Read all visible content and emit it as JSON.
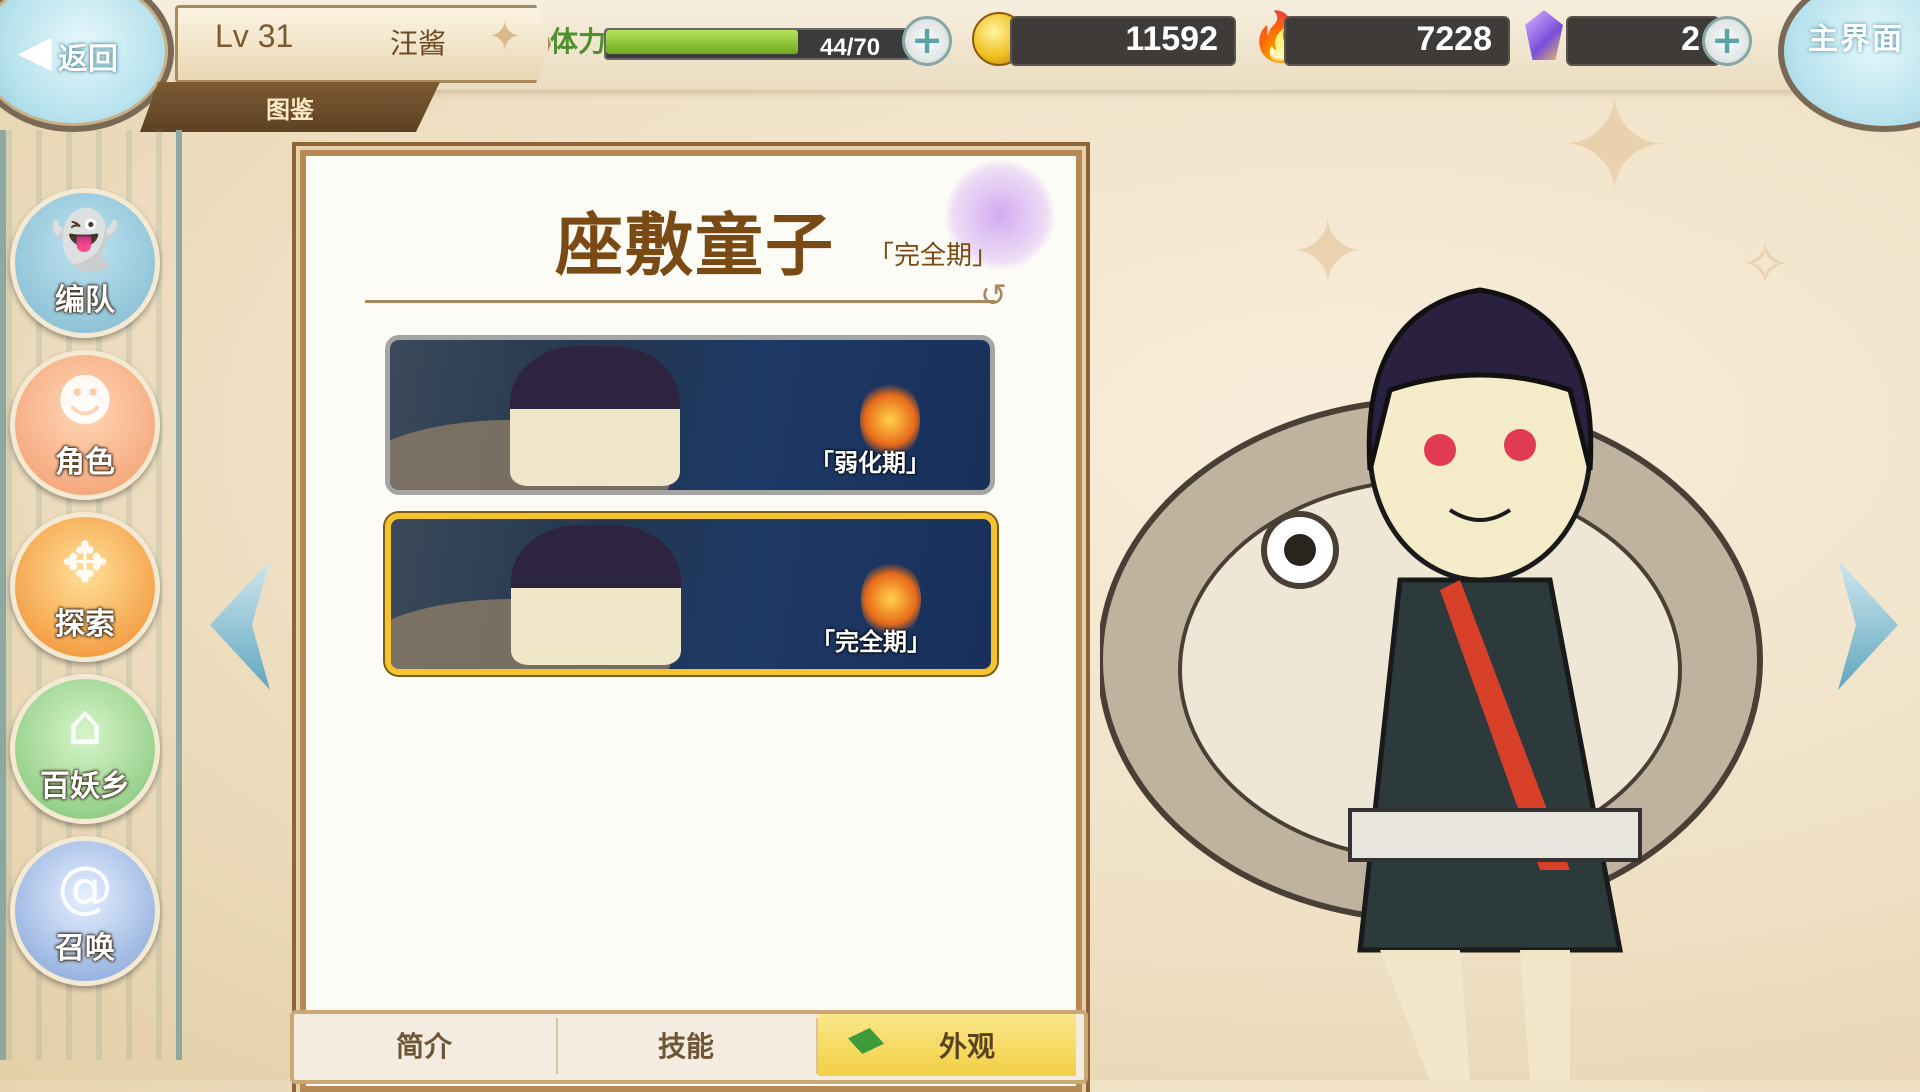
{
  "header": {
    "back_label": "返回",
    "level": "Lv 31",
    "player_name": "汪酱",
    "section_tab": "图鉴",
    "stamina_label": "体力",
    "stamina_text": "44/70",
    "stamina_fraction": 0.629,
    "gold": "11592",
    "soul": "7228",
    "gems": "2",
    "home_label": "主界面"
  },
  "nav": [
    {
      "label": "编队",
      "icon": "ghost-knight-icon"
    },
    {
      "label": "角色",
      "icon": "character-portrait-icon"
    },
    {
      "label": "探索",
      "icon": "scroll-compass-icon"
    },
    {
      "label": "百妖乡",
      "icon": "house-icon"
    },
    {
      "label": "召唤",
      "icon": "swirl-icon"
    }
  ],
  "codex": {
    "character_name": "座敷童子",
    "current_stage": "「完全期」",
    "skins": [
      {
        "stage": "「弱化期」",
        "selected": false
      },
      {
        "stage": "「完全期」",
        "selected": true
      }
    ]
  },
  "tabs": [
    {
      "label": "简介",
      "active": false
    },
    {
      "label": "技能",
      "active": false
    },
    {
      "label": "外观",
      "active": true
    }
  ],
  "colors": {
    "panel_border": "#b78a55",
    "selected_border": "#f3c330",
    "active_tab": "#f2cf45",
    "title_text": "#7a4a14"
  }
}
